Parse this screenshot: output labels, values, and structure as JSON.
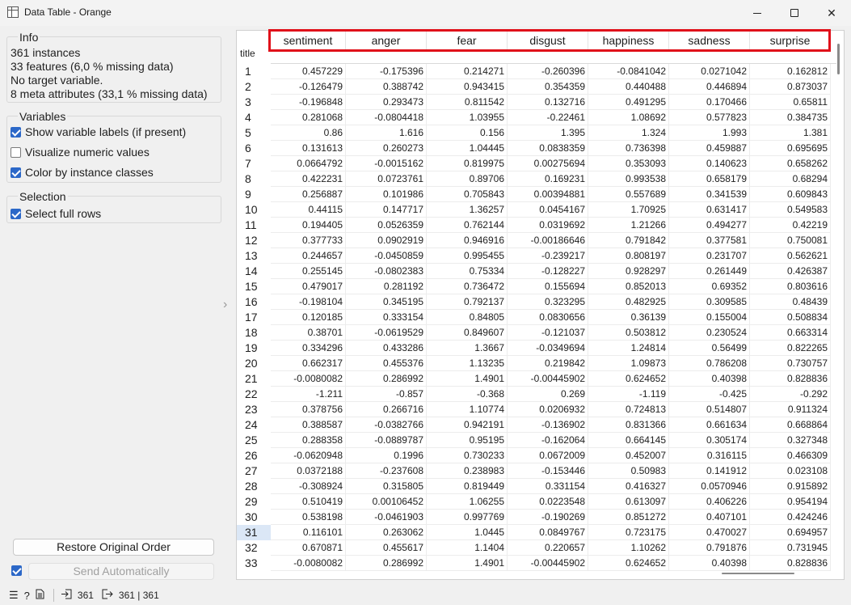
{
  "window": {
    "title": "Data Table - Orange",
    "min": "—",
    "max": "☐",
    "close": "✕"
  },
  "info": {
    "title": "Info",
    "lines": [
      "361 instances",
      "33  features (6,0 % missing data)",
      "No target variable.",
      "8 meta attributes (33,1 % missing data)"
    ]
  },
  "variables": {
    "title": "Variables",
    "options": [
      {
        "label": "Show variable labels (if present)",
        "checked": true
      },
      {
        "label": "Visualize numeric values",
        "checked": false
      },
      {
        "label": "Color by instance classes",
        "checked": true
      }
    ]
  },
  "selection": {
    "title": "Selection",
    "options": [
      {
        "label": "Select full rows",
        "checked": true
      }
    ]
  },
  "buttons": {
    "restore": "Restore Original Order",
    "send": "Send Automatically"
  },
  "table": {
    "row_label_header": "title",
    "columns": [
      "sentiment",
      "anger",
      "fear",
      "disgust",
      "happiness",
      "sadness",
      "surprise"
    ],
    "selected_row": "31",
    "rows": [
      [
        "1",
        "0.457229",
        "-0.175396",
        "0.214271",
        "-0.260396",
        "-0.0841042",
        "0.0271042",
        "0.162812"
      ],
      [
        "2",
        "-0.126479",
        "0.388742",
        "0.943415",
        "0.354359",
        "0.440488",
        "0.446894",
        "0.873037"
      ],
      [
        "3",
        "-0.196848",
        "0.293473",
        "0.811542",
        "0.132716",
        "0.491295",
        "0.170466",
        "0.65811"
      ],
      [
        "4",
        "0.281068",
        "-0.0804418",
        "1.03955",
        "-0.22461",
        "1.08692",
        "0.577823",
        "0.384735"
      ],
      [
        "5",
        "0.86",
        "1.616",
        "0.156",
        "1.395",
        "1.324",
        "1.993",
        "1.381"
      ],
      [
        "6",
        "0.131613",
        "0.260273",
        "1.04445",
        "0.0838359",
        "0.736398",
        "0.459887",
        "0.695695"
      ],
      [
        "7",
        "0.0664792",
        "-0.0015162",
        "0.819975",
        "0.00275694",
        "0.353093",
        "0.140623",
        "0.658262"
      ],
      [
        "8",
        "0.422231",
        "0.0723761",
        "0.89706",
        "0.169231",
        "0.993538",
        "0.658179",
        "0.68294"
      ],
      [
        "9",
        "0.256887",
        "0.101986",
        "0.705843",
        "0.00394881",
        "0.557689",
        "0.341539",
        "0.609843"
      ],
      [
        "10",
        "0.44115",
        "0.147717",
        "1.36257",
        "0.0454167",
        "1.70925",
        "0.631417",
        "0.549583"
      ],
      [
        "11",
        "0.194405",
        "0.0526359",
        "0.762144",
        "0.0319692",
        "1.21266",
        "0.494277",
        "0.42219"
      ],
      [
        "12",
        "0.377733",
        "0.0902919",
        "0.946916",
        "-0.00186646",
        "0.791842",
        "0.377581",
        "0.750081"
      ],
      [
        "13",
        "0.244657",
        "-0.0450859",
        "0.995455",
        "-0.239217",
        "0.808197",
        "0.231707",
        "0.562621"
      ],
      [
        "14",
        "0.255145",
        "-0.0802383",
        "0.75334",
        "-0.128227",
        "0.928297",
        "0.261449",
        "0.426387"
      ],
      [
        "15",
        "0.479017",
        "0.281192",
        "0.736472",
        "0.155694",
        "0.852013",
        "0.69352",
        "0.803616"
      ],
      [
        "16",
        "-0.198104",
        "0.345195",
        "0.792137",
        "0.323295",
        "0.482925",
        "0.309585",
        "0.48439"
      ],
      [
        "17",
        "0.120185",
        "0.333154",
        "0.84805",
        "0.0830656",
        "0.36139",
        "0.155004",
        "0.508834"
      ],
      [
        "18",
        "0.38701",
        "-0.0619529",
        "0.849607",
        "-0.121037",
        "0.503812",
        "0.230524",
        "0.663314"
      ],
      [
        "19",
        "0.334296",
        "0.433286",
        "1.3667",
        "-0.0349694",
        "1.24814",
        "0.56499",
        "0.822265"
      ],
      [
        "20",
        "0.662317",
        "0.455376",
        "1.13235",
        "0.219842",
        "1.09873",
        "0.786208",
        "0.730757"
      ],
      [
        "21",
        "-0.0080082",
        "0.286992",
        "1.4901",
        "-0.00445902",
        "0.624652",
        "0.40398",
        "0.828836"
      ],
      [
        "22",
        "-1.211",
        "-0.857",
        "-0.368",
        "0.269",
        "-1.119",
        "-0.425",
        "-0.292"
      ],
      [
        "23",
        "0.378756",
        "0.266716",
        "1.10774",
        "0.0206932",
        "0.724813",
        "0.514807",
        "0.911324"
      ],
      [
        "24",
        "0.388587",
        "-0.0382766",
        "0.942191",
        "-0.136902",
        "0.831366",
        "0.661634",
        "0.668864"
      ],
      [
        "25",
        "0.288358",
        "-0.0889787",
        "0.95195",
        "-0.162064",
        "0.664145",
        "0.305174",
        "0.327348"
      ],
      [
        "26",
        "-0.0620948",
        "0.1996",
        "0.730233",
        "0.0672009",
        "0.452007",
        "0.316115",
        "0.466309"
      ],
      [
        "27",
        "0.0372188",
        "-0.237608",
        "0.238983",
        "-0.153446",
        "0.50983",
        "0.141912",
        "0.023108"
      ],
      [
        "28",
        "-0.308924",
        "0.315805",
        "0.819449",
        "0.331154",
        "0.416327",
        "0.0570946",
        "0.915892"
      ],
      [
        "29",
        "0.510419",
        "0.00106452",
        "1.06255",
        "0.0223548",
        "0.613097",
        "0.406226",
        "0.954194"
      ],
      [
        "30",
        "0.538198",
        "-0.0461903",
        "0.997769",
        "-0.190269",
        "0.851272",
        "0.407101",
        "0.424246"
      ],
      [
        "31",
        "0.116101",
        "0.263062",
        "1.0445",
        "0.0849767",
        "0.723175",
        "0.470027",
        "0.694957"
      ],
      [
        "32",
        "0.670871",
        "0.455617",
        "1.1404",
        "0.220657",
        "1.10262",
        "0.791876",
        "0.731945"
      ],
      [
        "33",
        "-0.0080082",
        "0.286992",
        "1.4901",
        "-0.00445902",
        "0.624652",
        "0.40398",
        "0.828836"
      ]
    ]
  },
  "statusbar": {
    "menu_icon": "☰",
    "help_icon": "?",
    "report_icon": "🗎",
    "input_count": "361",
    "output_count": "361 | 361"
  },
  "icons": {
    "input": "input-arrow-icon",
    "output": "output-arrow-icon"
  },
  "colors": {
    "accent": "#2c68c8",
    "highlight": "#e0101a",
    "selected_row": "#dbe7f6"
  }
}
